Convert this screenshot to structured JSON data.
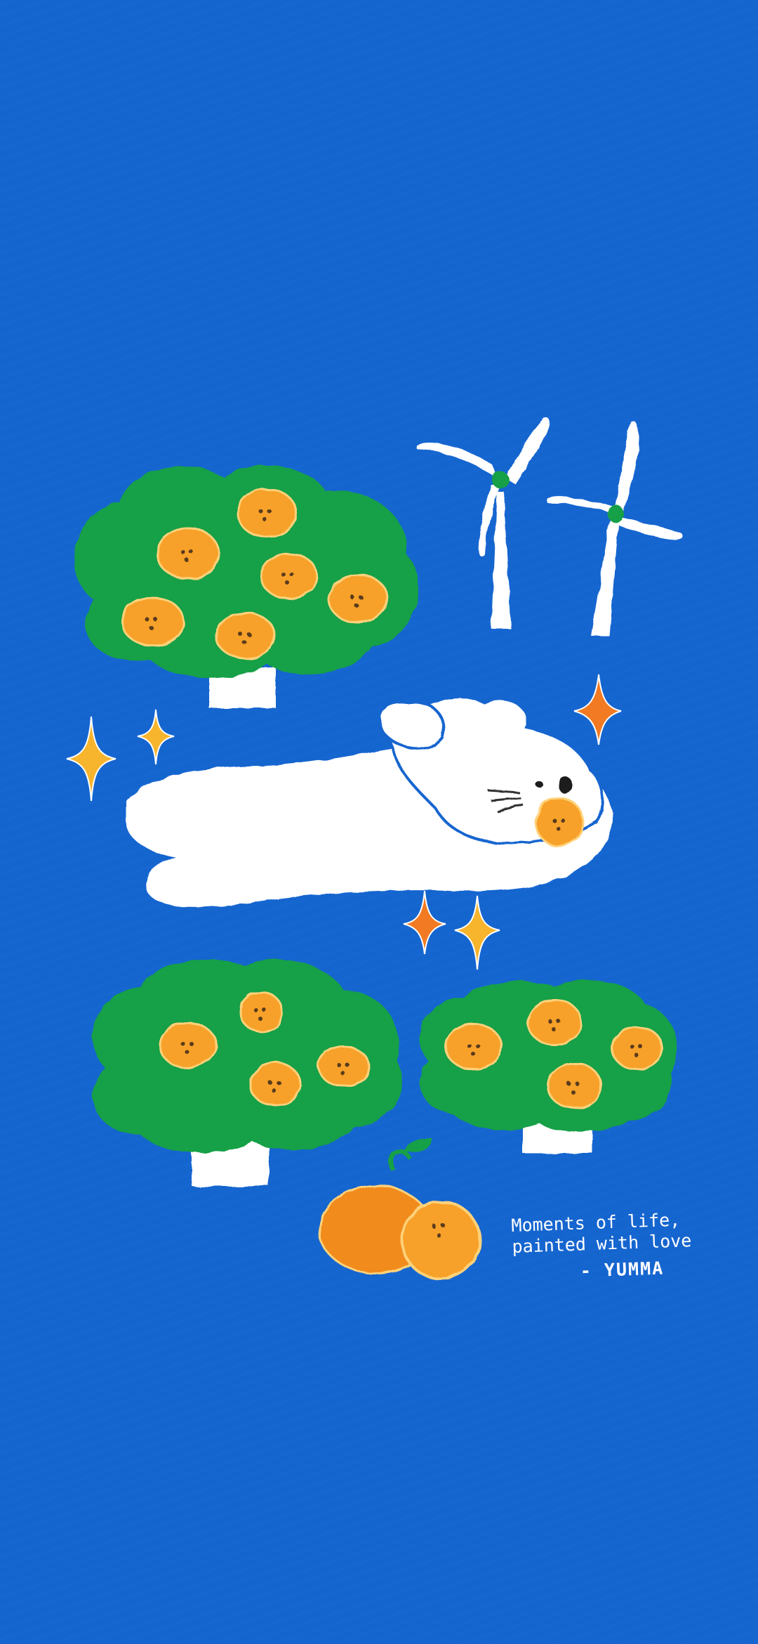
{
  "wallpaper": {
    "background_color": "#1565cf",
    "caption": {
      "line1": "Moments of life,",
      "line2": "painted with love",
      "signature": "- YUMMA"
    },
    "colors": {
      "tree_green": "#19a047",
      "fruit_orange": "#f7a12a",
      "fruit_dark": "#f18b1f",
      "white": "#ffffff",
      "sparkle_yellow": "#f7b42d",
      "sparkle_orange": "#f27a22",
      "windmill_hub": "#19a047"
    },
    "elements": [
      "orange-tree",
      "windmill",
      "white-dog",
      "sparkle-icon",
      "tangerine"
    ]
  }
}
